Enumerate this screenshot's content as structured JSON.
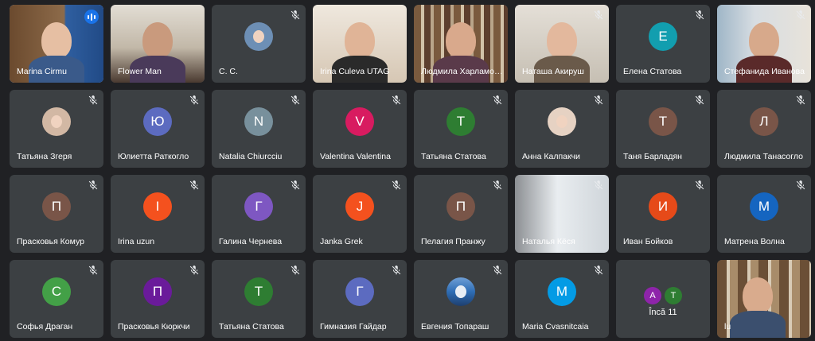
{
  "tiles": [
    {
      "name": "Marina Cirmu",
      "kind": "video",
      "speaking": true,
      "active": true
    },
    {
      "name": "Flower Man",
      "kind": "video"
    },
    {
      "name": "C. C.",
      "kind": "photo",
      "muted": true
    },
    {
      "name": "Irina Culeva UTAG",
      "kind": "video"
    },
    {
      "name": "Людмила Харламова",
      "kind": "video"
    },
    {
      "name": "Наташа Акируш",
      "kind": "video",
      "muted": true
    },
    {
      "name": "Елена Статова",
      "kind": "initial",
      "initial": "Е",
      "color": "#129eaf",
      "muted": true
    },
    {
      "name": "Стефанида Иванова",
      "kind": "video",
      "muted": true
    },
    {
      "name": "Татьяна Згеря",
      "kind": "photo",
      "muted": true
    },
    {
      "name": "Юлиетта Раткогло",
      "kind": "initial",
      "initial": "Ю",
      "color": "#5c6bc0",
      "muted": true
    },
    {
      "name": "Natalia Chiurcciu",
      "kind": "initial",
      "initial": "N",
      "color": "#78909c",
      "muted": true
    },
    {
      "name": "Valentina Valentina",
      "kind": "initial",
      "initial": "V",
      "color": "#d81b60",
      "muted": true
    },
    {
      "name": "Татьяна Статова",
      "kind": "initial",
      "initial": "Т",
      "color": "#2e7d32",
      "muted": true
    },
    {
      "name": "Анна Калпакчи",
      "kind": "photo",
      "muted": true
    },
    {
      "name": "Таня Барладян",
      "kind": "initial",
      "initial": "Т",
      "color": "#795548",
      "muted": true
    },
    {
      "name": "Людмила Танасогло",
      "kind": "initial",
      "initial": "Л",
      "color": "#795548",
      "muted": true
    },
    {
      "name": "Прасковья Комур",
      "kind": "initial",
      "initial": "П",
      "color": "#795548",
      "muted": true
    },
    {
      "name": "Irina uzun",
      "kind": "initial",
      "initial": "I",
      "color": "#f4511e",
      "muted": true
    },
    {
      "name": "Галина Чернева",
      "kind": "initial",
      "initial": "Г",
      "color": "#7e57c2",
      "muted": true
    },
    {
      "name": "Janka Grek",
      "kind": "initial",
      "initial": "J",
      "color": "#f4511e",
      "muted": true
    },
    {
      "name": "Пелагия Пранжу",
      "kind": "initial",
      "initial": "П",
      "color": "#795548",
      "muted": true
    },
    {
      "name": "Наталья Кёся",
      "kind": "video",
      "muted": true
    },
    {
      "name": "Иван Бойков",
      "kind": "initial",
      "initial": "И",
      "color": "#e64a19",
      "muted": true
    },
    {
      "name": "Матрена Волна",
      "kind": "initial",
      "initial": "М",
      "color": "#1565c0",
      "muted": true
    },
    {
      "name": "Софья Драган",
      "kind": "initial",
      "initial": "С",
      "color": "#43a047",
      "muted": true
    },
    {
      "name": "Прасковья Кюркчи",
      "kind": "initial",
      "initial": "П",
      "color": "#6a1b9a",
      "muted": true
    },
    {
      "name": "Татьяна Статова",
      "kind": "initial",
      "initial": "Т",
      "color": "#2e7d32",
      "muted": true
    },
    {
      "name": "Гимназия Гайдар",
      "kind": "initial",
      "initial": "Г",
      "color": "#5c6bc0",
      "muted": true
    },
    {
      "name": "Евгения Топараш",
      "kind": "photo",
      "muted": true
    },
    {
      "name": "Maria Cvasnitcaia",
      "kind": "initial",
      "initial": "M",
      "color": "#039be5",
      "muted": true
    },
    {
      "name": "",
      "kind": "others",
      "label": "Încă 11",
      "minis": [
        {
          "initial": "A",
          "color": "#8e24aa"
        },
        {
          "initial": "T",
          "color": "#2e7d32"
        }
      ]
    },
    {
      "name": "lu",
      "kind": "video"
    }
  ],
  "icons": {
    "mic_off": "mic-off-icon",
    "speaking": "audio-level-icon"
  }
}
